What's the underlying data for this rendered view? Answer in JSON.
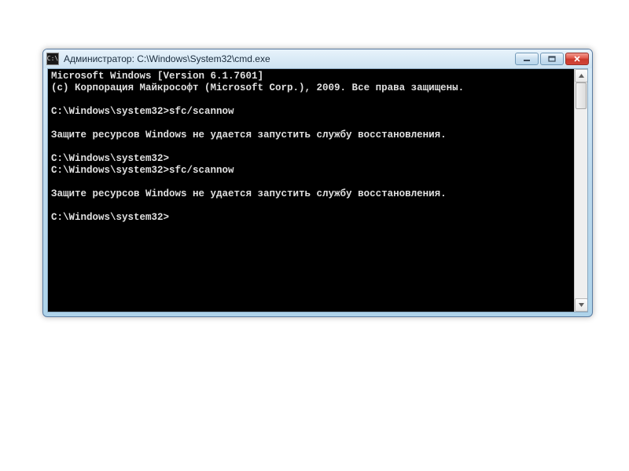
{
  "window": {
    "title": "Администратор: C:\\Windows\\System32\\cmd.exe",
    "icon_glyph": "C:\\"
  },
  "console": {
    "lines": [
      "Microsoft Windows [Version 6.1.7601]",
      "(c) Корпорация Майкрософт (Microsoft Corp.), 2009. Все права защищены.",
      "",
      "C:\\Windows\\system32>sfc/scannow",
      "",
      "Защите ресурсов Windows не удается запустить службу восстановления.",
      "",
      "C:\\Windows\\system32>",
      "C:\\Windows\\system32>sfc/scannow",
      "",
      "Защите ресурсов Windows не удается запустить службу восстановления.",
      "",
      "C:\\Windows\\system32>"
    ]
  }
}
